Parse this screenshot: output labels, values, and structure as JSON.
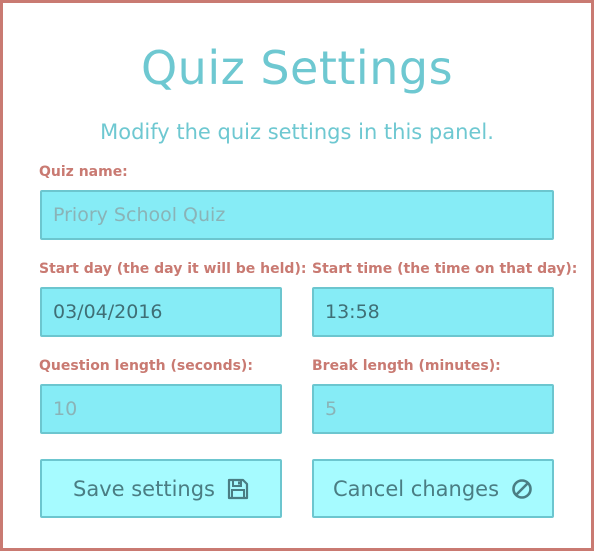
{
  "header": {
    "title": "Quiz Settings",
    "subtitle": "Modify the quiz settings in this panel."
  },
  "form": {
    "quiz_name": {
      "label": "Quiz name:",
      "placeholder": "Priory School Quiz"
    },
    "start_day": {
      "label": "Start day (the day it will be held):",
      "value": "03/04/2016"
    },
    "start_time": {
      "label": "Start time (the time on that day):",
      "value": "13:58"
    },
    "question_length": {
      "label": "Question length (seconds):",
      "placeholder": "10"
    },
    "break_length": {
      "label": "Break length (minutes):",
      "placeholder": "5"
    }
  },
  "actions": {
    "save_label": "Save settings",
    "save_icon": "floppy-disk-icon",
    "cancel_label": "Cancel changes",
    "cancel_icon": "ban-icon"
  },
  "colors": {
    "accent": "#6ec8d1",
    "label": "#c97a72",
    "field_bg": "#86ecf6",
    "button_bg": "#a6fbff",
    "border": "#c97a72"
  }
}
